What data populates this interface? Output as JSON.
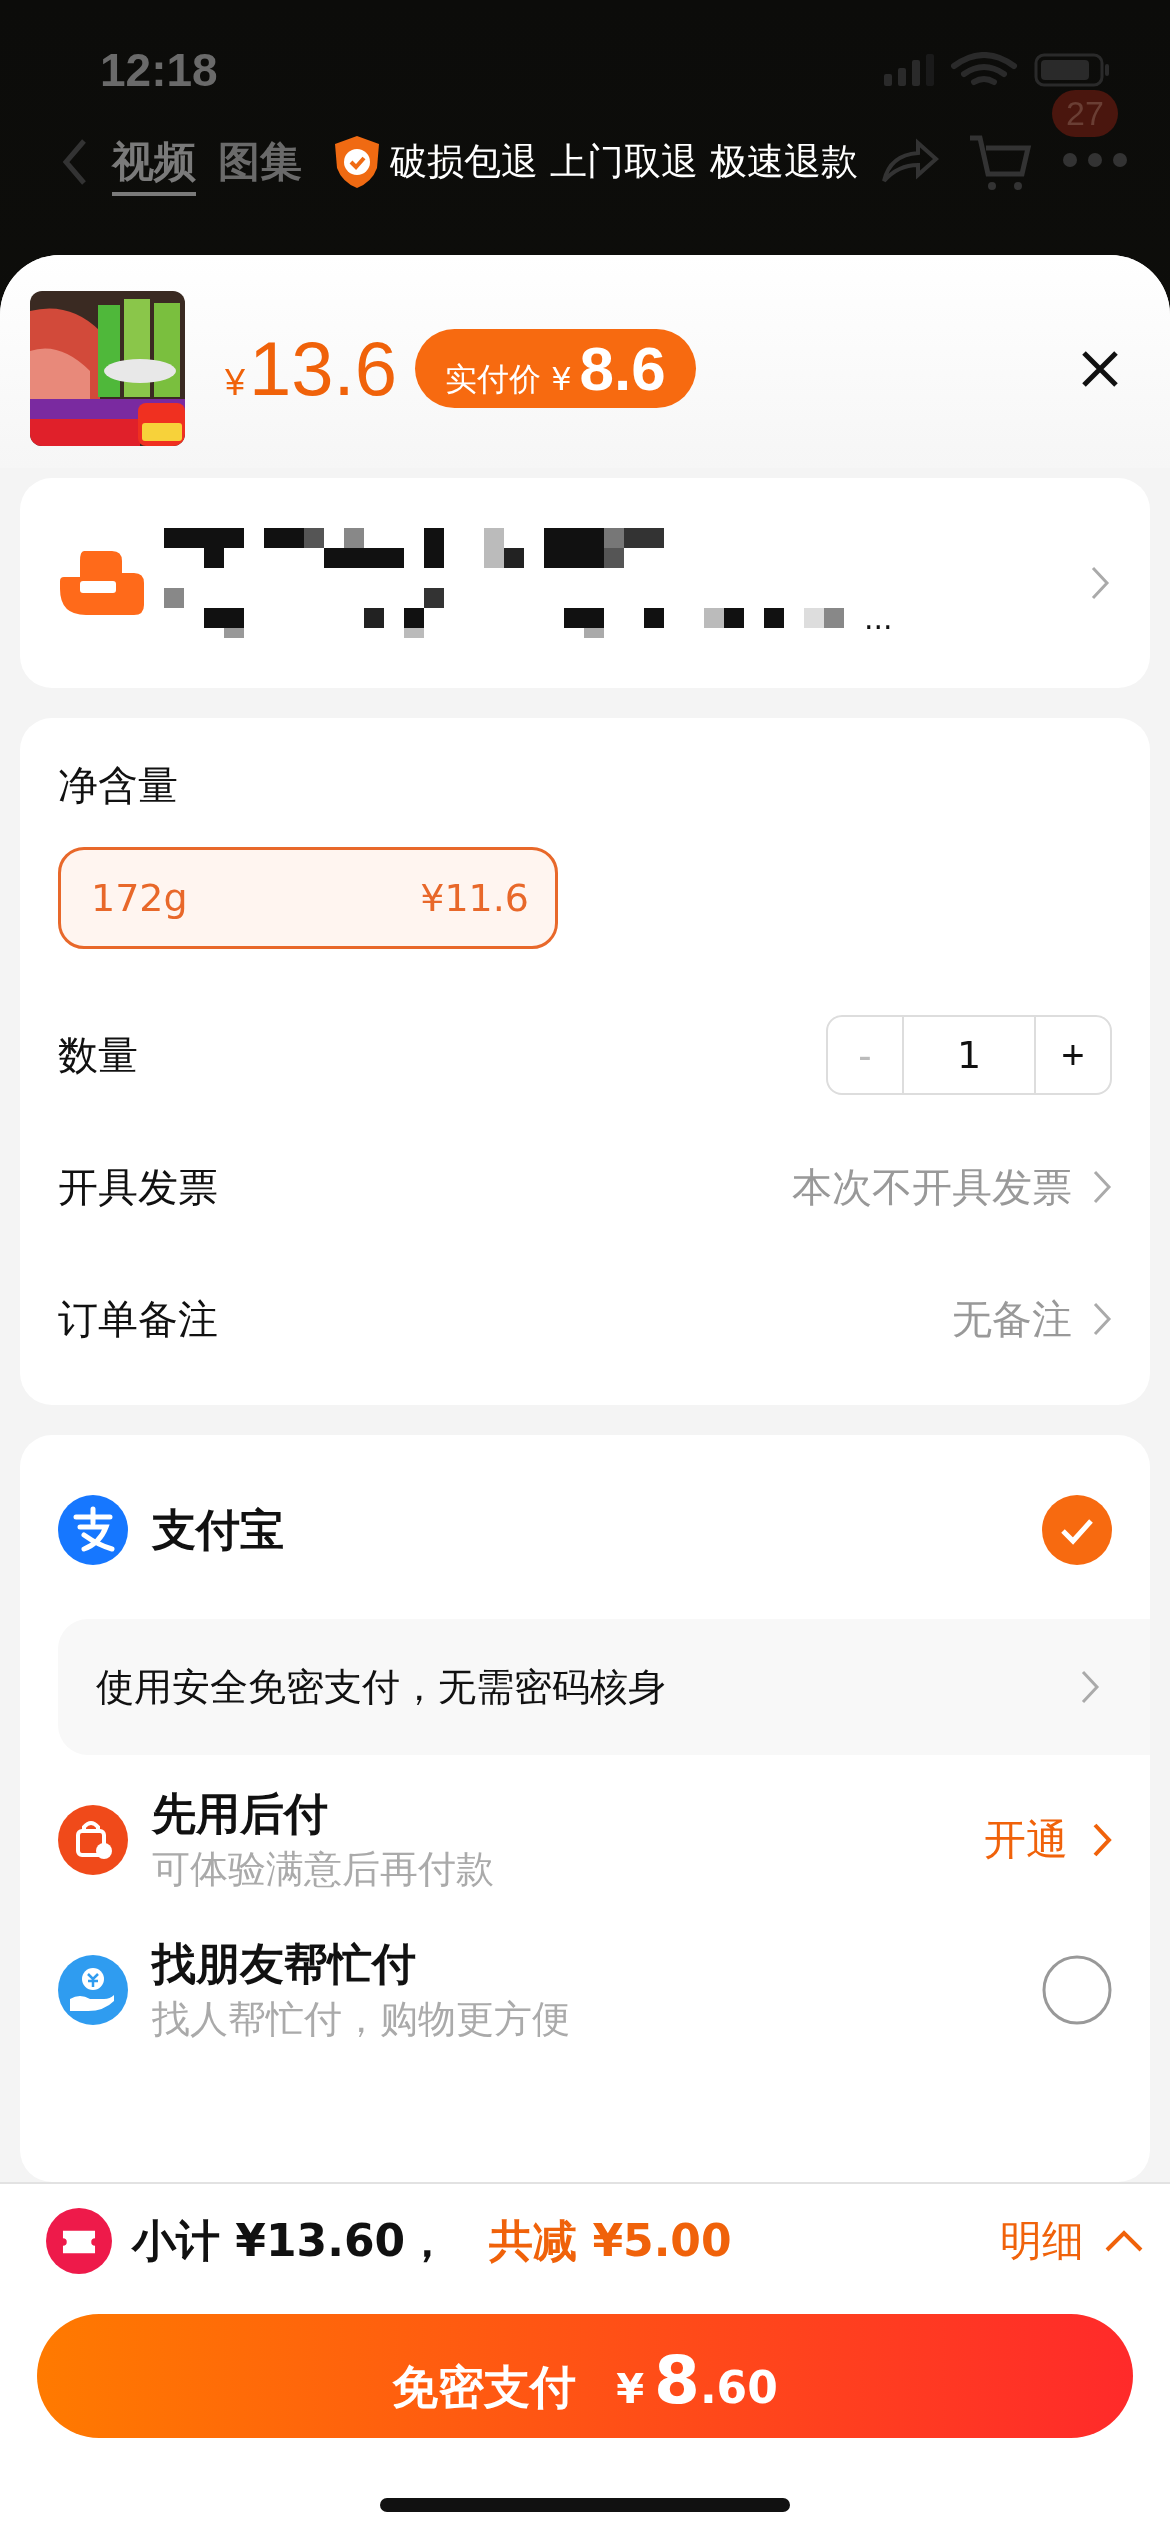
{
  "status_bar": {
    "time": "12:18"
  },
  "background_nav": {
    "tabs": [
      {
        "label": "视频",
        "selected": true
      },
      {
        "label": "图集",
        "selected": false
      }
    ],
    "guarantee": "破损包退 上门取退 极速退款",
    "cart_badge": "27"
  },
  "product": {
    "currency": "¥",
    "price": "13.6",
    "actual_price": {
      "label": "实付价",
      "currency": "¥",
      "value": "8.6"
    }
  },
  "address": {
    "ellipsis": "..."
  },
  "spec": {
    "title": "净含量",
    "options": [
      {
        "label": "172g",
        "price": "¥11.6",
        "selected": true
      }
    ]
  },
  "quantity": {
    "label": "数量",
    "minus": "-",
    "value": "1",
    "plus": "+",
    "minus_disabled": true
  },
  "rows": [
    {
      "label": "开具发票",
      "value": "本次不开具发票"
    },
    {
      "label": "订单备注",
      "value": "无备注"
    }
  ],
  "payment": {
    "methods": [
      {
        "kind": "alipay",
        "title": "支付宝",
        "selected": true,
        "banner": "使用安全免密支付，无需密码核身"
      },
      {
        "kind": "paylater",
        "title": "先用后付",
        "subtitle": "可体验满意后再付款",
        "action": "开通"
      },
      {
        "kind": "friend",
        "title": "找朋友帮忙付",
        "subtitle": "找人帮忙付，购物更方便",
        "selected": false
      }
    ]
  },
  "summary": {
    "subtotal": "小计 ¥13.60，",
    "discount": "共减 ¥5.00",
    "detail": "明细",
    "expanded": false
  },
  "pay_button": {
    "label": "免密支付",
    "currency": "¥",
    "amount": "8",
    "decimals": ".60"
  }
}
